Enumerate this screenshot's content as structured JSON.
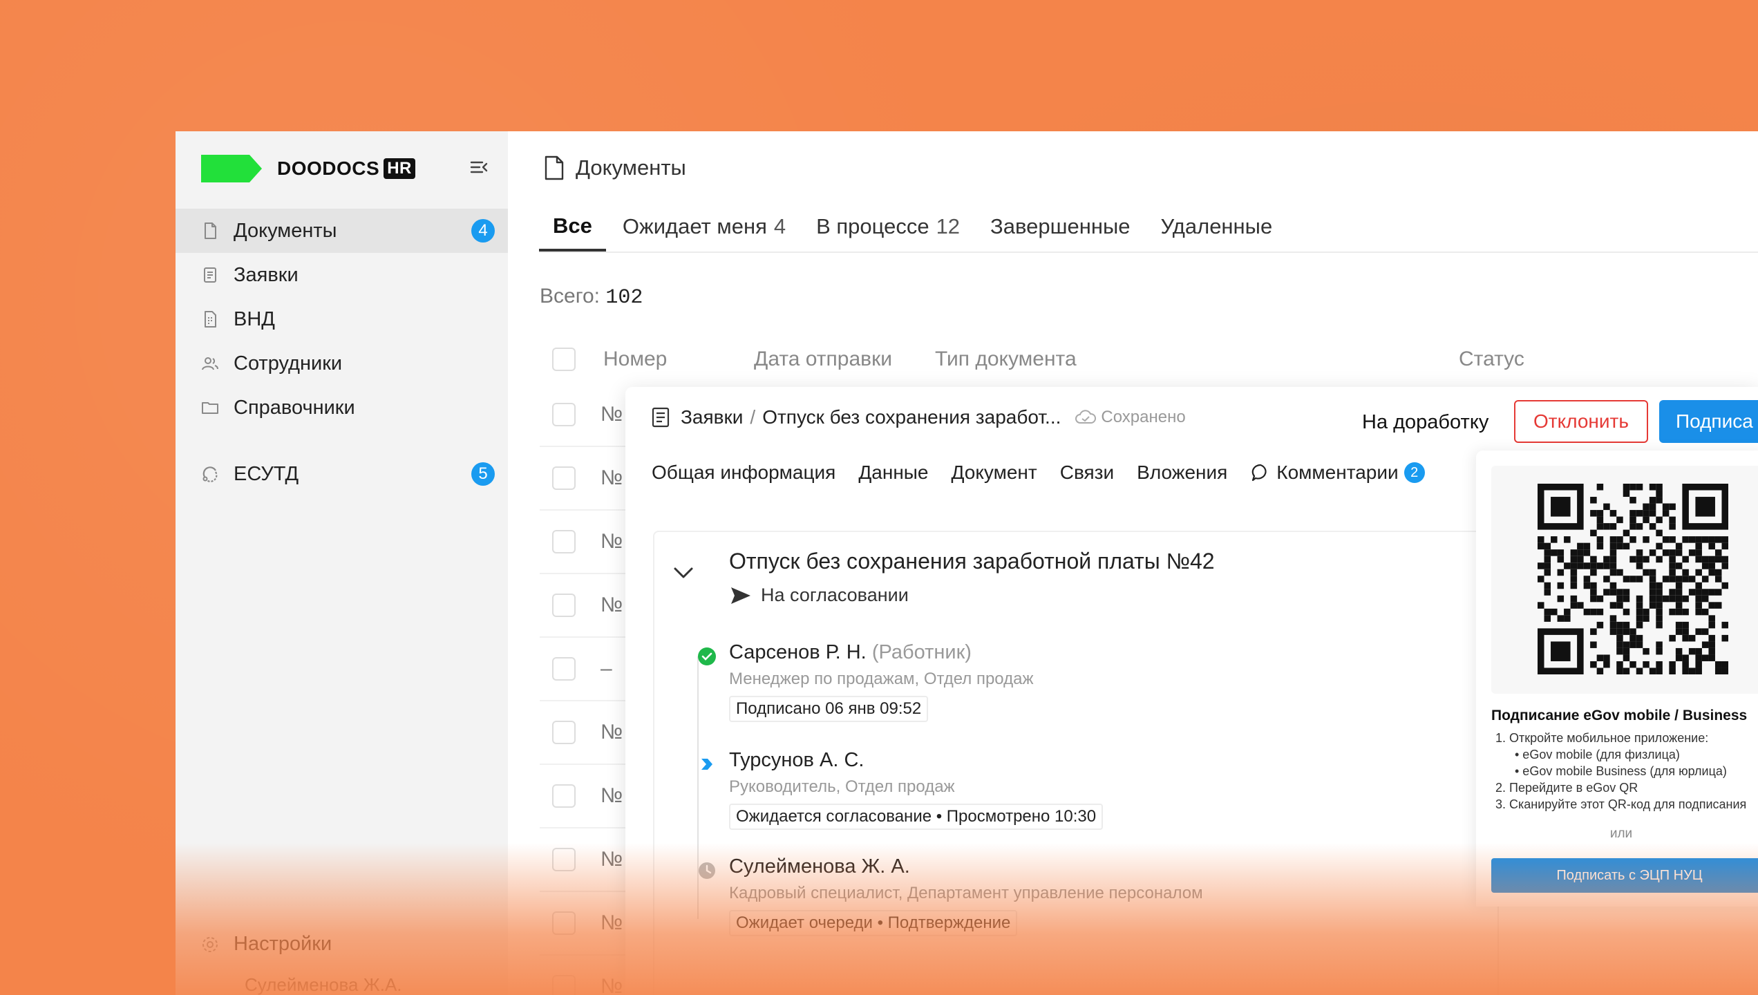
{
  "brand": {
    "name": "DOODOCS",
    "suffix": "HR",
    "color": "#22e03a"
  },
  "sidebar": {
    "items": [
      {
        "label": "Документы",
        "icon": "document-icon",
        "badge": "4",
        "active": true
      },
      {
        "label": "Заявки",
        "icon": "requests-icon"
      },
      {
        "label": "ВНД",
        "icon": "vnd-icon"
      },
      {
        "label": "Сотрудники",
        "icon": "users-icon"
      },
      {
        "label": "Справочники",
        "icon": "folder-icon"
      }
    ],
    "esutd": {
      "label": "ЕСУТД",
      "badge": "5"
    },
    "settings": "Настройки",
    "user": "Сулейменова Ж.А."
  },
  "main": {
    "title": "Документы",
    "tabs": [
      {
        "label": "Все",
        "count": ""
      },
      {
        "label": "Ожидает меня",
        "count": "4"
      },
      {
        "label": "В процессе",
        "count": "12"
      },
      {
        "label": "Завершенные",
        "count": ""
      },
      {
        "label": "Удаленные",
        "count": ""
      }
    ],
    "total_label": "Всего:",
    "total_value": "102",
    "columns": [
      "Номер",
      "Дата отправки",
      "Тип документа",
      "Статус"
    ],
    "rows": [
      "№",
      "№",
      "№",
      "№",
      "–",
      "№",
      "№",
      "№",
      "№",
      "№"
    ]
  },
  "panel": {
    "crumb_root": "Заявки",
    "crumb_sep": "/",
    "crumb_doc": "Отпуск без сохранения заработ...",
    "saved": "Сохранено",
    "rework": "На доработку",
    "reject": "Отклонить",
    "sign": "Подписа",
    "tabs": [
      "Общая информация",
      "Данные",
      "Документ",
      "Связи",
      "Вложения"
    ],
    "comments": {
      "label": "Комментарии",
      "count": "2"
    },
    "card": {
      "title": "Отпуск без сохранения заработной платы №42",
      "status": "На согласовании",
      "steps": [
        {
          "name": "Сарсенов Р. Н.",
          "role": "(Работник)",
          "position": "Менеджер по продажам, Отдел продаж",
          "tag": "Подписано 06 янв 09:52",
          "state": "done"
        },
        {
          "name": "Турсунов А. С.",
          "role": "",
          "position": "Руководитель, Отдел продаж",
          "tag": "Ожидается согласование • Просмотрено 10:30",
          "state": "current"
        },
        {
          "name": "Сулейменова Ж. А.",
          "role": "",
          "position": "Кадровый специалист, Департамент управление персоналом",
          "tag": "Ожидает очереди • Подтверждение",
          "state": "waiting"
        }
      ]
    }
  },
  "qr": {
    "title": "Подписание eGov mobile / Business",
    "step1": "1. Откройте мобильное приложение:",
    "step1a": "• eGov mobile (для физлица)",
    "step1b": "• eGov mobile Business (для юрлица)",
    "step2": "2. Перейдите в eGov QR",
    "step3": "3. Сканируйте этот QR-код для подписания",
    "or": "или",
    "button": "Подписать с ЭЦП НУЦ"
  },
  "colors": {
    "accent": "#1a8fe8",
    "danger": "#e53935",
    "success": "#1fb84a",
    "background": "#f4844a"
  }
}
